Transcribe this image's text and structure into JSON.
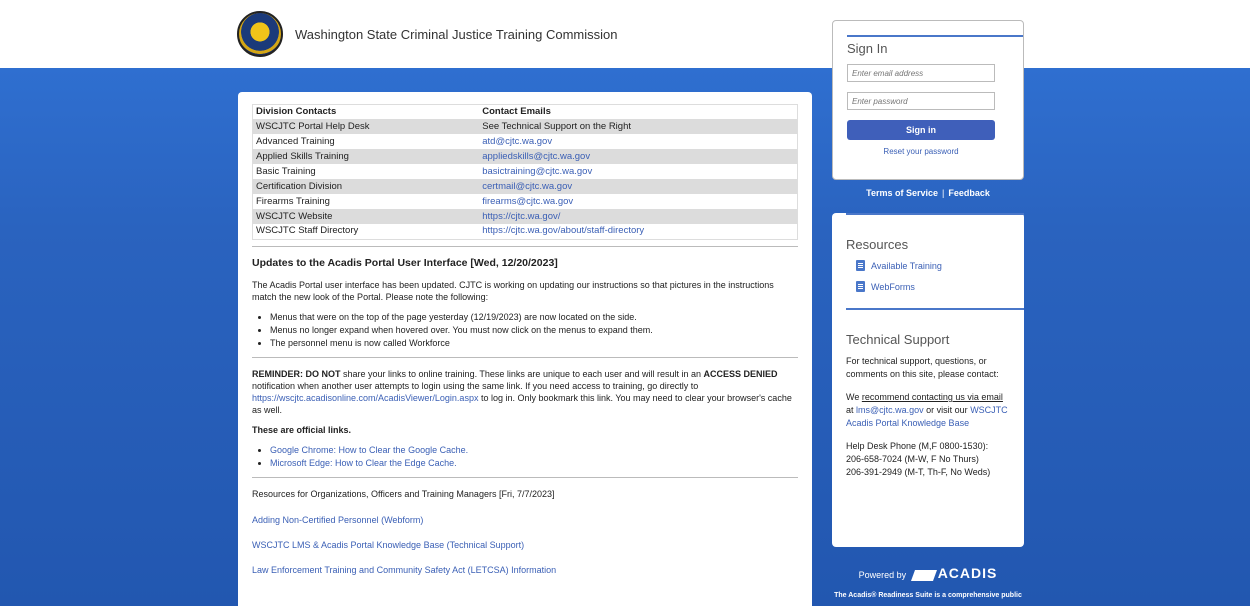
{
  "header": {
    "org_name": "Washington State Criminal Justice Training Commission"
  },
  "contacts": {
    "headers": [
      "Division Contacts",
      "Contact Emails"
    ],
    "rows": [
      [
        "WSCJTC Portal Help Desk",
        "See Technical Support on the Right"
      ],
      [
        "Advanced Training",
        "atd@cjtc.wa.gov"
      ],
      [
        "Applied Skills Training",
        "appliedskills@cjtc.wa.gov"
      ],
      [
        "Basic Training",
        "basictraining@cjtc.wa.gov"
      ],
      [
        "Certification Division",
        "certmail@cjtc.wa.gov"
      ],
      [
        "Firearms Training",
        "firearms@cjtc.wa.gov"
      ],
      [
        "WSCJTC Website",
        "https://cjtc.wa.gov/"
      ],
      [
        "WSCJTC Staff Directory",
        "https://cjtc.wa.gov/about/staff-directory"
      ]
    ]
  },
  "update": {
    "heading": "Updates to the Acadis Portal User Interface [Wed, 12/20/2023]",
    "intro": "The Acadis Portal user interface has been updated. CJTC is working on updating our instructions so that pictures in the instructions match the new look of the Portal. Please note the following:",
    "bullets": [
      "Menus that were on the top of the page yesterday (12/19/2023) are now located on the side.",
      "Menus no longer expand when hovered over. You must now click on the menus to expand them.",
      "The personnel menu is now called Workforce"
    ]
  },
  "reminder": {
    "lead": "REMINDER: DO NOT",
    "text1": " share your links to online training. These links are unique to each user and will result in an ",
    "access_denied": "ACCESS DENIED",
    "text2": " notification when another user attempts to login using the same link. If you need access to training, go directly to ",
    "login_link": "https://wscjtc.acadisonline.com/AcadisViewer/Login.aspx",
    "text3": " to log in. Only bookmark this link. You may need to clear your browser's cache as well.",
    "official": "These are official links.",
    "links": [
      "Google Chrome: How to Clear the Google Cache.",
      "Microsoft Edge: How to Clear the Edge Cache."
    ]
  },
  "resources_section": {
    "heading": "Resources for Organizations, Officers and Training Managers [Fri, 7/7/2023]",
    "links": [
      "Adding Non-Certified Personnel (Webform)",
      "WSCJTC LMS & Acadis Portal Knowledge Base (Technical Support)",
      "Law Enforcement Training and Community Safety Act (LETCSA) Information"
    ]
  },
  "signin": {
    "title": "Sign In",
    "email_placeholder": "Enter email address",
    "password_placeholder": "Enter password",
    "button": "Sign in",
    "reset": "Reset your password"
  },
  "footer_links": {
    "terms": "Terms of Service",
    "separator": "|",
    "feedback": "Feedback"
  },
  "resources_panel": {
    "title": "Resources",
    "items": [
      {
        "label": "Available Training",
        "icon": "document-icon"
      },
      {
        "label": "WebForms",
        "icon": "document-icon"
      }
    ]
  },
  "tech_support": {
    "title": "Technical Support",
    "intro": "For technical support, questions, or comments on this site, please contact:",
    "we": "We ",
    "recommend": "recommend contacting us via email",
    "at": " at ",
    "email": "lms@cjtc.wa.gov",
    "or_visit": " or visit our ",
    "kb_link": "WSCJTC Acadis Portal Knowledge Base",
    "phone_label": "Help Desk Phone (M,F 0800-1530):",
    "phone1": "206-658-7024 (M-W, F No Thurs)",
    "phone2": "206-391-2949 (M-T, Th-F, No Weds)"
  },
  "powered": {
    "label": "Powered by",
    "brand": "ACADIS",
    "note": "The Acadis® Readiness Suite is a comprehensive public"
  },
  "colors": {
    "band": "#2a63bf",
    "accent": "#4a77c9",
    "button": "#3f5fba",
    "link": "#3a5fb5"
  }
}
